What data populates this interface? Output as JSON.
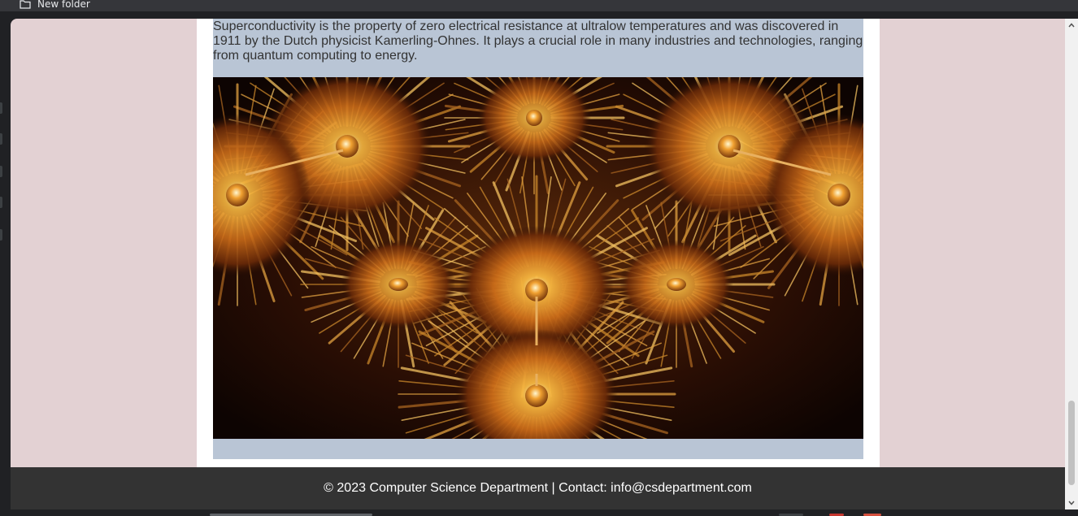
{
  "bookmarks": {
    "items": [
      {
        "label": "New folder",
        "icon": "folder-icon"
      }
    ]
  },
  "article": {
    "intro_text": "Superconductivity is the property of zero electrical resistance at ultralow temperatures and was discovered in 1911 by the Dutch physicist Kamerling-Ohnes. It plays a crucial role in many industries and technologies, ranging from quantum computing to energy.",
    "image": {
      "icon": "fractal-image",
      "colors": [
        "#f0a030",
        "#7a3a0c",
        "#1a0804"
      ]
    }
  },
  "footer": {
    "text": "© 2023 Computer Science Department | Contact: info@csdepartment.com"
  },
  "colors": {
    "page_background": "#e3d1d3",
    "content_block": "#b9c5d5",
    "footer_background": "#333333",
    "browser_chrome": "#202124"
  }
}
